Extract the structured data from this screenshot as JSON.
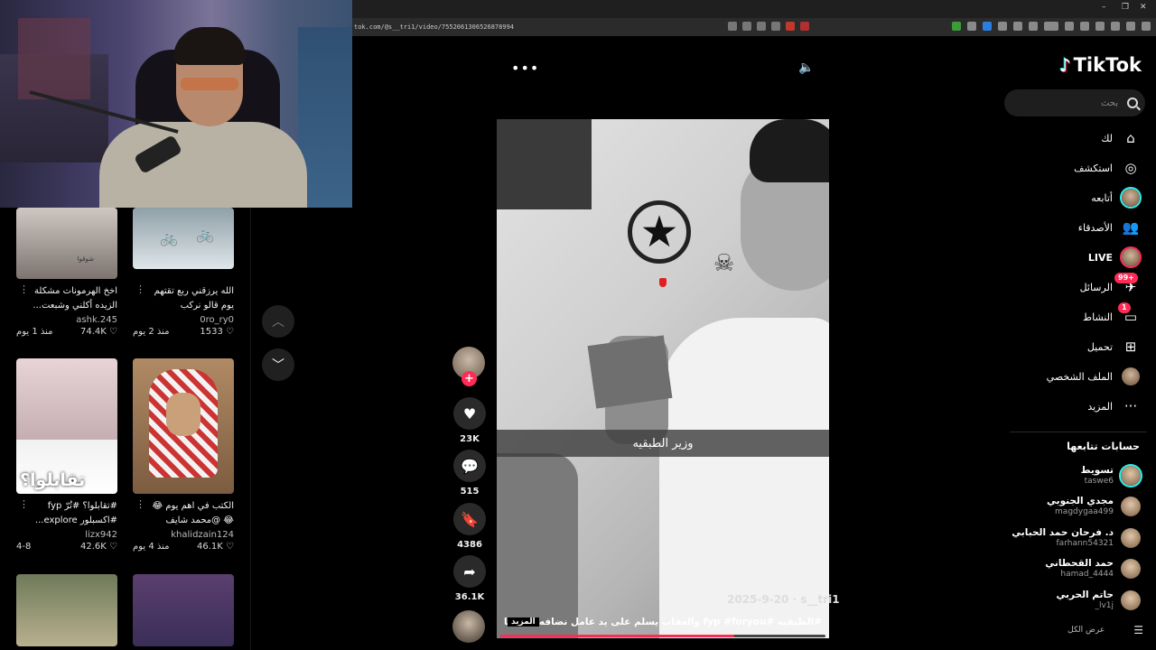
{
  "browser": {
    "url": "tok.com/@s__tri1/video/7552061306526878994",
    "window_controls": [
      "–",
      "❐",
      "✕"
    ]
  },
  "sidebar": {
    "logo": "TikTok",
    "search_placeholder": "بحث",
    "nav": [
      {
        "label": "لك",
        "icon": "home-icon"
      },
      {
        "label": "استكشف",
        "icon": "compass-icon"
      },
      {
        "label": "أتابعه",
        "icon": "following-avatar"
      },
      {
        "label": "الأصدقاء",
        "icon": "friends-icon"
      },
      {
        "label": "LIVE",
        "icon": "live-avatar"
      },
      {
        "label": "الرسائل",
        "icon": "messages-icon",
        "badge": "+99"
      },
      {
        "label": "النشاط",
        "icon": "activity-icon",
        "badge": "1"
      },
      {
        "label": "تحميل",
        "icon": "upload-icon"
      },
      {
        "label": "الملف الشخصي",
        "icon": "profile-avatar"
      },
      {
        "label": "المزيد",
        "icon": "more-icon"
      }
    ],
    "following_heading": "حسابات تتابعها",
    "accounts": [
      {
        "name": "تسويط",
        "handle": "taswe6"
      },
      {
        "name": "مجدي الجنوبي",
        "handle": "magdygaa499"
      },
      {
        "name": "د. فرحان حمد الحبابي",
        "handle": "farhann54321"
      },
      {
        "name": "حمد القحطاني",
        "handle": "hamad_4444"
      },
      {
        "name": "حاتم الحربي",
        "handle": "_lv1j"
      }
    ],
    "see_all": "عرض الكل"
  },
  "video": {
    "caption_overlay": "وزير الطبقيه",
    "author": "s__tri1",
    "date": "2025-9-20",
    "meta_line": "2025-9-20 · s__tri1",
    "description": "#الطبقيه #fyp #foryou والعقاب يسلم على يد عامل نضافه #انستا ...",
    "more": "المزيد",
    "progress": 0.72,
    "likes": "23K",
    "comments": "515",
    "saves": "4386",
    "shares": "36.1K"
  },
  "related": [
    {
      "title": "اخخ الهرمونات مشكلة الزيده أكلني وشبعت...",
      "author": "ashk.245",
      "likes": "74.4K",
      "age": "منذ 1 يوم",
      "thumb_text": "شوقوا"
    },
    {
      "title": "الله يرزقني ربع تقتهم يوم قالو نركب معك#شوتق...",
      "author": "0ro_ry0",
      "likes": "1533",
      "age": "منذ 2 يوم"
    },
    {
      "title": "#تقابلوا؟ #تُرّ fyp #اكسبلور explore...",
      "author": "lizx942",
      "likes": "42.6K",
      "age": "4-8",
      "thumb_text": "تقابلوا؟"
    },
    {
      "title": "الكتب في اهم يوم 😂😂 @محمد شايف",
      "author": "khalidzain124",
      "likes": "46.1K",
      "age": "منذ 4 يوم"
    },
    {
      "title": "",
      "author": "",
      "likes": "",
      "age": ""
    },
    {
      "title": "",
      "author": "",
      "likes": "",
      "age": ""
    }
  ]
}
